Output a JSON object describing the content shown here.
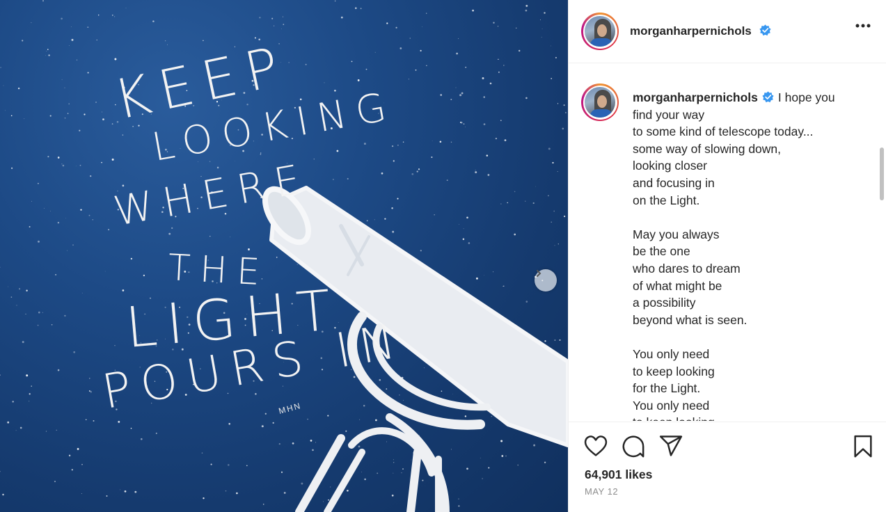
{
  "post": {
    "image_alt_text_lines": [
      "KEEP",
      "LOOKING",
      "WHERE",
      "THE",
      "LIGHT",
      "POURS IN"
    ],
    "image_signature": "MHN",
    "next_icon": "chevron-right-icon"
  },
  "header": {
    "username": "morganharpernichols",
    "verified_icon": "verified-badge-icon",
    "more_icon": "more-horizontal-icon"
  },
  "caption": {
    "username": "morganharpernichols",
    "first_line": "I hope you",
    "lines": [
      "find your way",
      "to some kind of telescope today...",
      "some way of slowing down,",
      "looking closer",
      "and focusing in",
      "on the Light.",
      "",
      "May you always",
      "be the one",
      "who dares to dream",
      "of what might be",
      "a possibility",
      "beyond what is seen.",
      "",
      "You only need",
      "to keep looking",
      "for the Light.",
      "You only need",
      "to keep looking."
    ]
  },
  "actions": {
    "like_icon": "heart-icon",
    "comment_icon": "comment-icon",
    "share_icon": "share-icon",
    "save_icon": "bookmark-icon",
    "likes": "64,901 likes",
    "date": "MAY 12"
  },
  "colors": {
    "accent_blue": "#3897f0",
    "text": "#262626",
    "muted": "#8e8e8e",
    "image_bg": "#1d4a86"
  }
}
